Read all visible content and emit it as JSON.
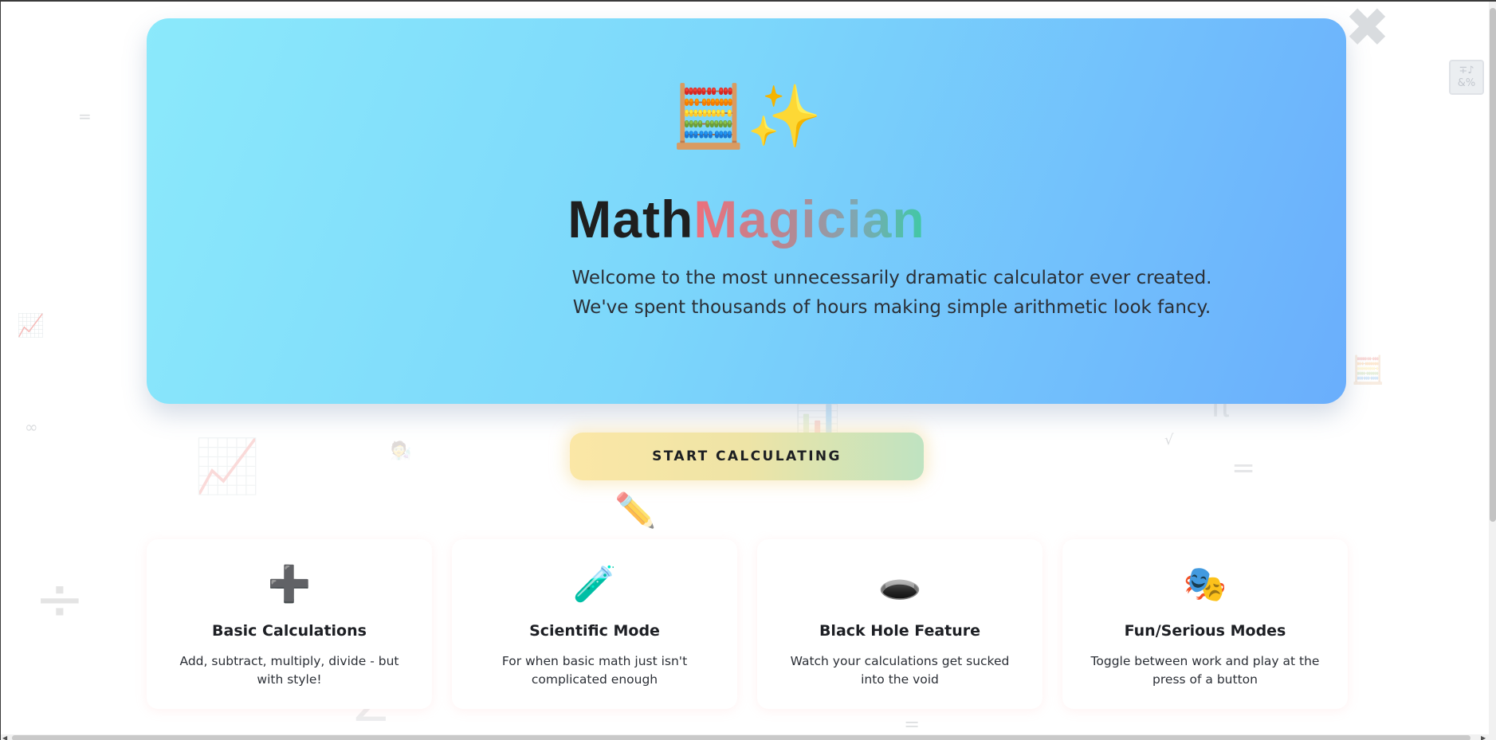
{
  "window": {
    "close_symbol": "✖"
  },
  "hero": {
    "emoji": "🧮✨",
    "title_main": "Math",
    "title_accent": "Magician",
    "subtitle": "Welcome to the most unnecessarily dramatic calculator ever created. We've spent thousands of hours making simple arithmetic look fancy."
  },
  "cta": {
    "label": "START CALCULATING"
  },
  "mini_panel": {
    "text": "∓♪ &%"
  },
  "features": [
    {
      "icon": "➕",
      "icon_name": "plus-icon",
      "title": "Basic Calculations",
      "desc": "Add, subtract, multiply, divide - but with style!"
    },
    {
      "icon": "🧪",
      "icon_name": "test-tube-icon",
      "title": "Scientific Mode",
      "desc": "For when basic math just isn't complicated enough"
    },
    {
      "icon": "🕳️",
      "icon_name": "hole-icon",
      "title": "Black Hole Feature",
      "desc": "Watch your calculations get sucked into the void"
    },
    {
      "icon": "🎭",
      "icon_name": "theater-masks-icon",
      "title": "Fun/Serious Modes",
      "desc": "Toggle between work and play at the press of a button"
    }
  ],
  "decorations": [
    "=",
    "📈",
    "∞",
    "📈",
    "÷",
    "🧑‍🔬",
    "✏️",
    "📊",
    "√",
    "=",
    "π",
    "🧮",
    "∑",
    "+",
    "=",
    "√",
    "✏️",
    "🔢"
  ],
  "colors": {
    "hero_start": "#8be9fb",
    "hero_end": "#6aaefc",
    "accent_red": "#ee6f7b",
    "accent_teal": "#3fc9a5"
  }
}
